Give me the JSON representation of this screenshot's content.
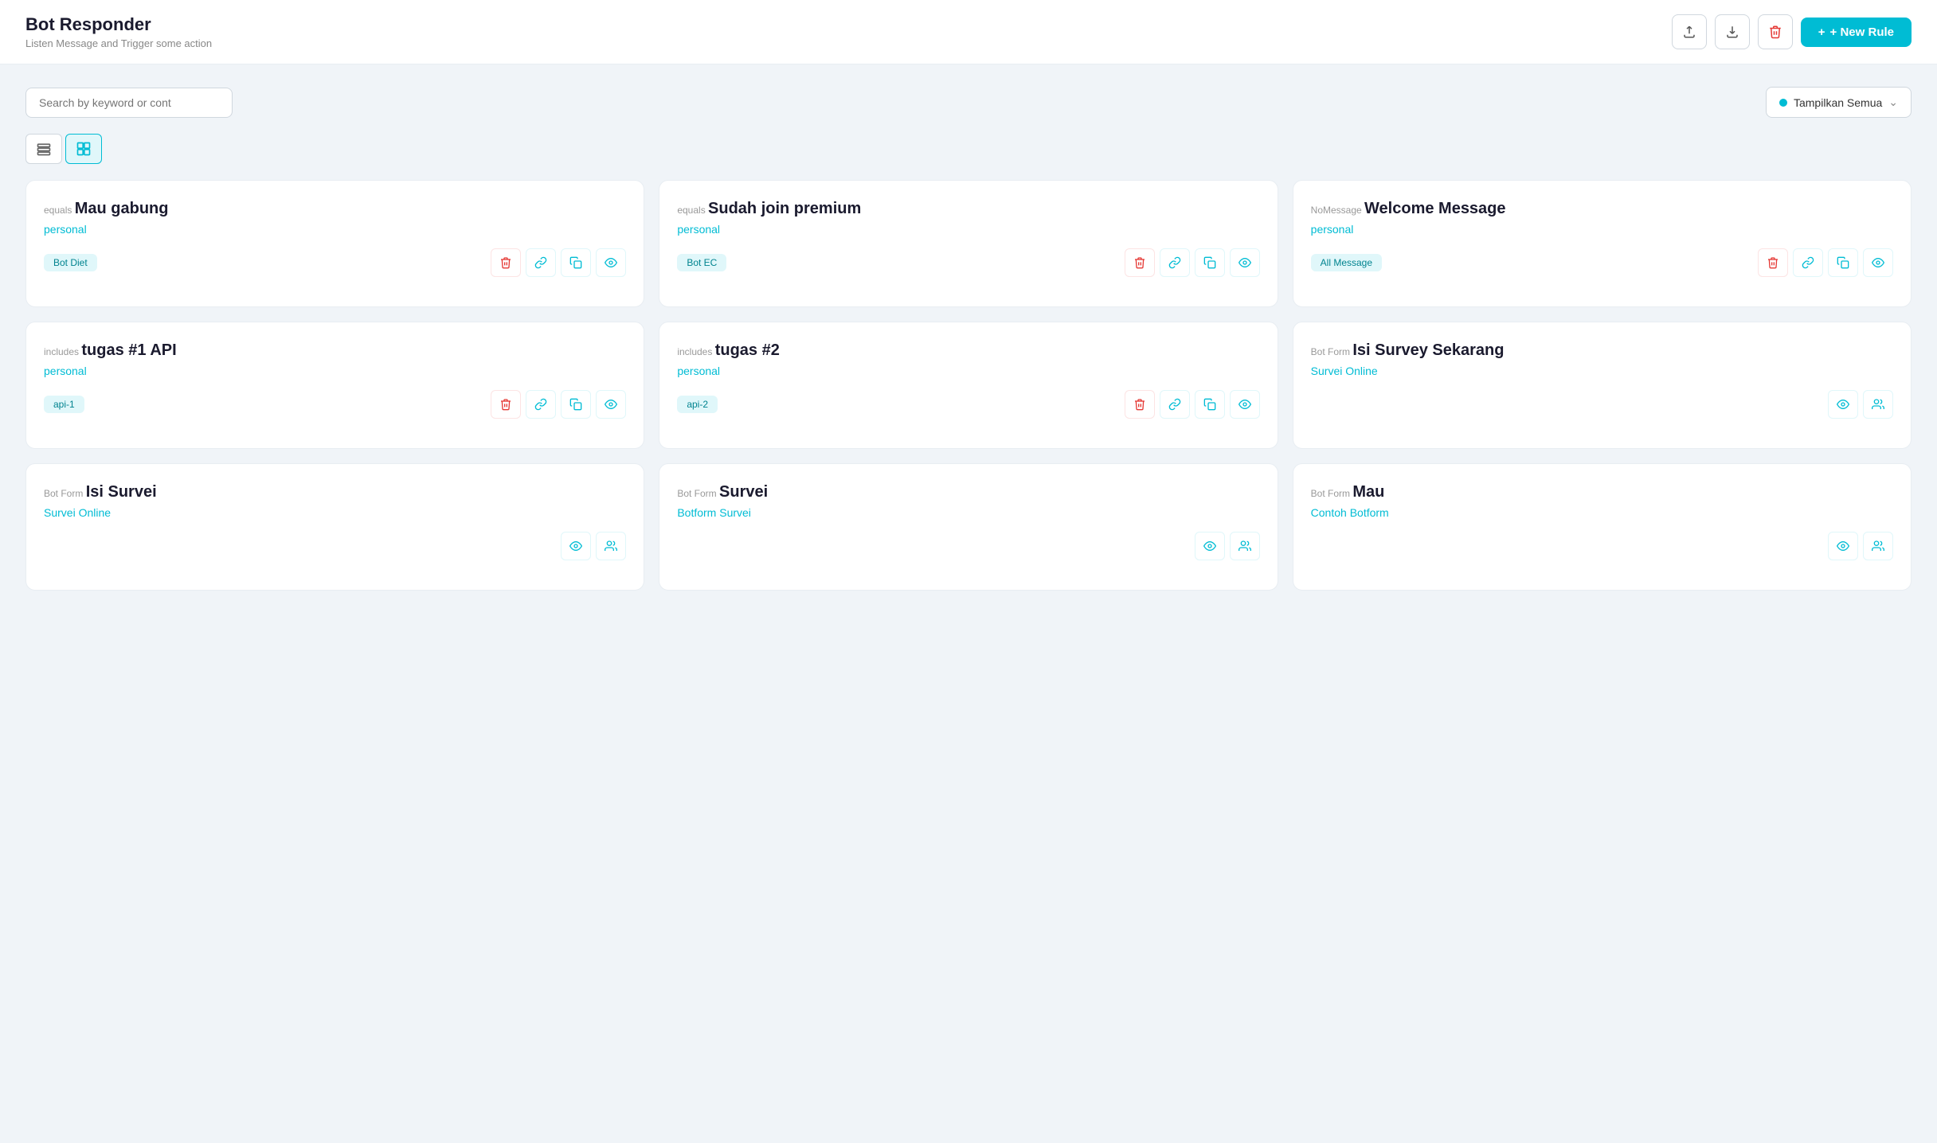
{
  "header": {
    "title": "Bot Responder",
    "subtitle": "Listen Message and Trigger some action",
    "actions": {
      "export_label": "export",
      "download_label": "download",
      "delete_label": "delete",
      "new_rule_label": "+ New Rule"
    }
  },
  "toolbar": {
    "search_placeholder": "Search by keyword or cont",
    "filter_label": "Tampilkan Semua"
  },
  "view_toggle": {
    "list_label": "list view",
    "grid_label": "grid view"
  },
  "cards": [
    {
      "type": "equals",
      "title": "Mau gabung",
      "link": "personal",
      "tag": "Bot Diet",
      "actions": [
        "delete",
        "link",
        "copy",
        "view"
      ]
    },
    {
      "type": "equals",
      "title": "Sudah join premium",
      "link": "personal",
      "tag": "Bot EC",
      "actions": [
        "delete",
        "link",
        "copy",
        "view"
      ]
    },
    {
      "type": "NoMessage",
      "title": "Welcome Message",
      "link": "personal",
      "tag": "All Message",
      "actions": [
        "delete",
        "link",
        "copy",
        "view"
      ]
    },
    {
      "type": "includes",
      "title": "tugas #1 API",
      "link": "personal",
      "tag": "api-1",
      "actions": [
        "delete",
        "link",
        "copy",
        "view"
      ]
    },
    {
      "type": "includes",
      "title": "tugas #2",
      "link": "personal",
      "tag": "api-2",
      "actions": [
        "delete",
        "link",
        "copy",
        "view"
      ]
    },
    {
      "type": "Bot Form",
      "title": "Isi Survey Sekarang",
      "link": "Survei Online",
      "tag": null,
      "actions": [
        "view",
        "users"
      ]
    },
    {
      "type": "Bot Form",
      "title": "Isi Survei",
      "link": "Survei Online",
      "tag": null,
      "actions": [
        "view",
        "users"
      ]
    },
    {
      "type": "Bot Form",
      "title": "Survei",
      "link": "Botform Survei",
      "tag": null,
      "actions": [
        "view",
        "users"
      ]
    },
    {
      "type": "Bot Form",
      "title": "Mau",
      "link": "Contoh Botform",
      "tag": null,
      "actions": [
        "view",
        "users"
      ]
    }
  ]
}
